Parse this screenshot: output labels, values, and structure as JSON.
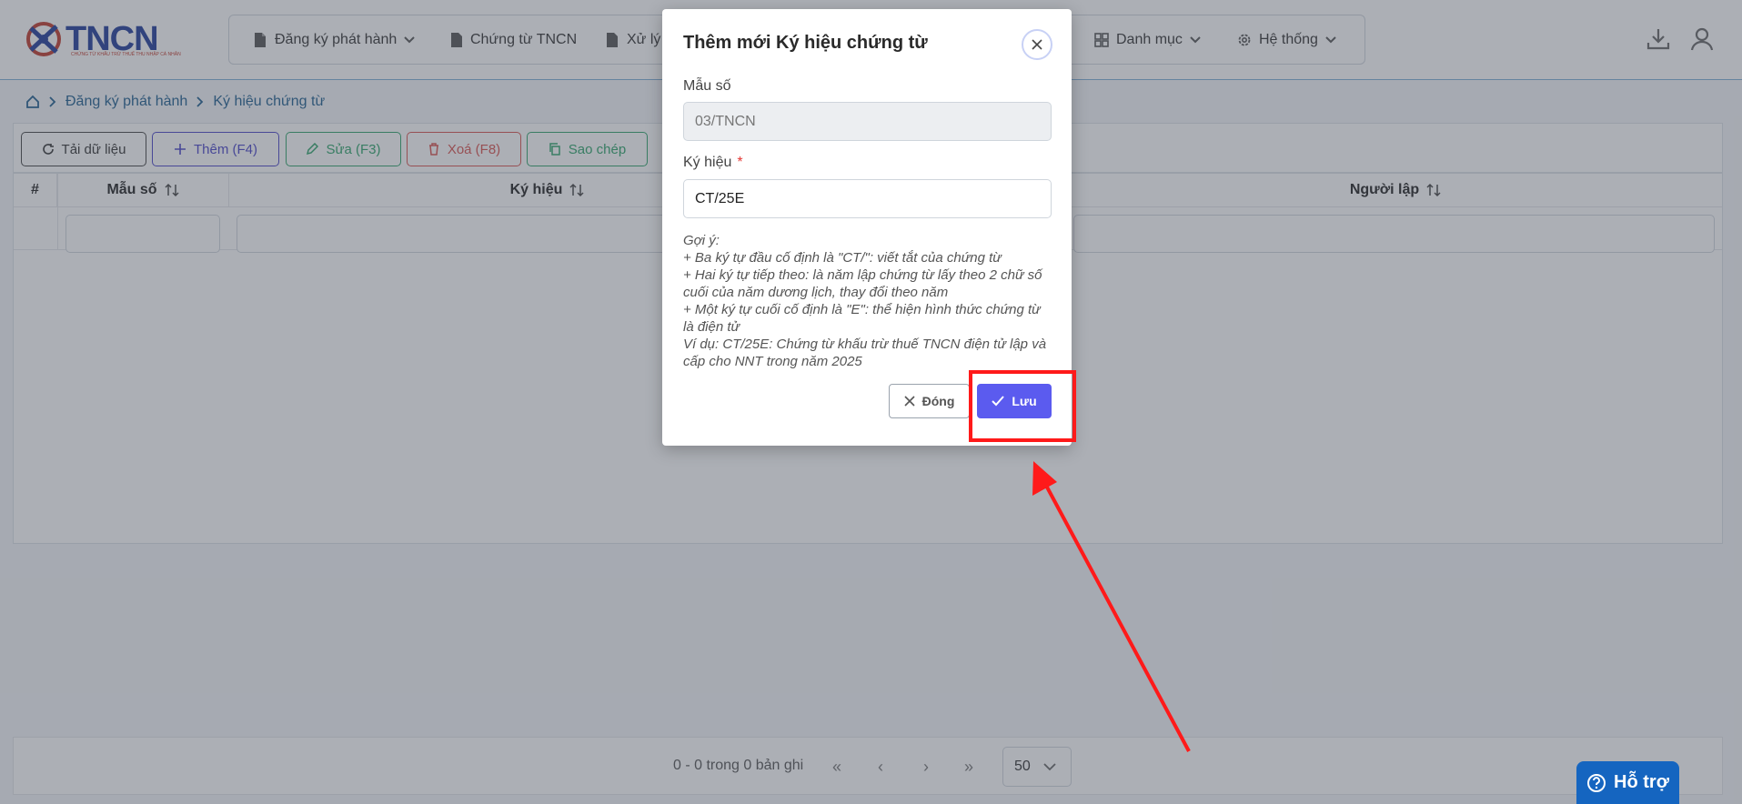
{
  "header": {
    "logo": {
      "word": "TNCN",
      "tagline": "CHỨNG TỪ KHẤU TRỪ THUẾ THU NHẬP CÁ NHÂN"
    },
    "menu": [
      {
        "label": "Đăng ký phát hành",
        "icon": "document-icon",
        "has_dropdown": true
      },
      {
        "label": "Chứng từ TNCN",
        "icon": "document-icon",
        "has_dropdown": false
      },
      {
        "label": "Xử lý",
        "icon": "document-icon",
        "has_dropdown": true
      },
      {
        "label": "Danh mục",
        "icon": "grid-icon",
        "has_dropdown": true
      },
      {
        "label": "Hệ thống",
        "icon": "gear-icon",
        "has_dropdown": true
      }
    ],
    "right_icons": [
      "download-icon",
      "user-icon"
    ]
  },
  "breadcrumb": {
    "items": [
      "Đăng ký phát hành",
      "Ký hiệu chứng từ"
    ]
  },
  "toolbar": {
    "buttons": [
      {
        "label": "Tải dữ liệu",
        "icon": "refresh-icon",
        "color": "#333333"
      },
      {
        "label": "Thêm (F4)",
        "icon": "plus-icon",
        "color": "#4a44c8"
      },
      {
        "label": "Sửa (F3)",
        "icon": "pencil-icon",
        "color": "#2ea56b"
      },
      {
        "label": "Xoá (F8)",
        "icon": "trash-icon",
        "color": "#d9534f"
      },
      {
        "label": "Sao chép",
        "icon": "copy-icon",
        "color": "#2ea56b"
      }
    ]
  },
  "table": {
    "columns": [
      "#",
      "Mẫu số",
      "Ký hiệu",
      "Người lập"
    ]
  },
  "pagination": {
    "summary": "0 - 0 trong 0 bản ghi",
    "page_size": "50"
  },
  "support": {
    "label": "Hỗ trợ"
  },
  "modal": {
    "title": "Thêm mới Ký hiệu chứng từ",
    "fields": {
      "mau_so": {
        "label": "Mẫu số",
        "value": "03/TNCN"
      },
      "ky_hieu": {
        "label": "Ký hiệu",
        "required_mark": "*",
        "value": "CT/25E"
      }
    },
    "hint_lines": [
      "Gợi ý:",
      "+ Ba ký tự đầu cố định là \"CT/\": viết tắt của chứng từ",
      "+ Hai ký tự tiếp theo: là năm lập chứng từ lấy theo 2 chữ số cuối của năm dương lịch, thay đổi theo năm",
      "+ Một ký tự cuối cố định là \"E\": thể hiện hình thức chứng từ là điện tử",
      "Ví dụ: CT/25E: Chứng từ khấu trừ thuế TNCN điện tử lập và cấp cho NNT trong năm 2025"
    ],
    "close_label": "Đóng",
    "save_label": "Lưu"
  },
  "colors": {
    "primary": "#5b5bef",
    "annotation_red": "#ff1a1a",
    "brand_blue": "#1f3b99",
    "support_blue": "#1565c0"
  }
}
